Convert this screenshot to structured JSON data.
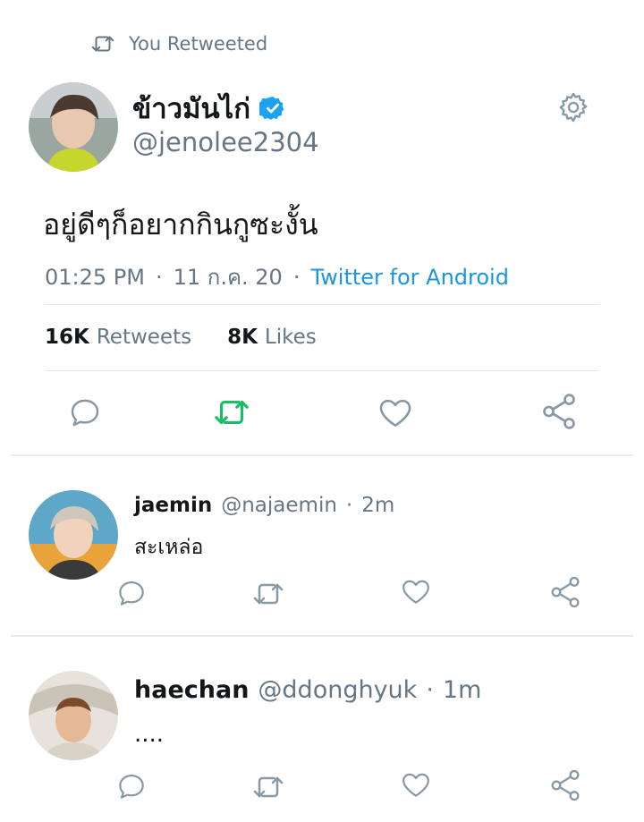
{
  "retweet_context": {
    "icon": "retweet-icon",
    "label": "You Retweeted"
  },
  "tweet": {
    "author_name": "ข้าวมันไก่",
    "author_handle": "@jenolee2304",
    "verified": true,
    "text": "อยู่ดีๆก็อยากกินกูซะงั้น",
    "time": "01:25 PM",
    "date": "11 ก.ค. 20",
    "source": "Twitter for Android",
    "retweets_count": "16K",
    "retweets_label": "Retweets",
    "likes_count": "8K",
    "likes_label": "Likes"
  },
  "replies": [
    {
      "name": "jaemin",
      "handle": "@najaemin",
      "time": "2m",
      "text": "สะเหล่อ"
    },
    {
      "name": "haechan",
      "handle": "@ddonghyuk",
      "time": "1m",
      "text": "...."
    }
  ],
  "colors": {
    "retweet_active": "#17bf63",
    "link": "#1b95e0",
    "muted": "#657786",
    "verified": "#1da1f2"
  },
  "separators": {
    "dot": "·"
  }
}
